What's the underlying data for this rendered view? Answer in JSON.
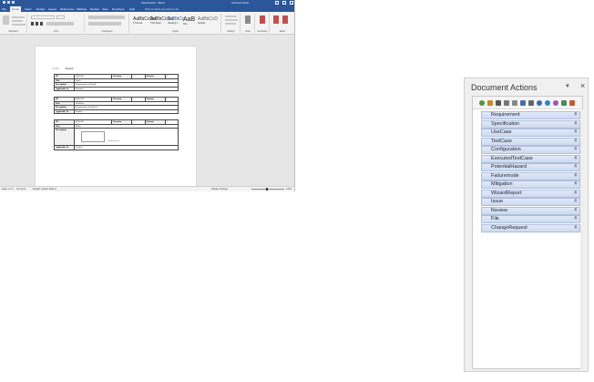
{
  "word": {
    "title": "Document1 - Word",
    "user": "Account name",
    "tabs": [
      "File",
      "Home",
      "Insert",
      "Design",
      "Layout",
      "References",
      "Mailings",
      "Review",
      "View",
      "Developer",
      "Help"
    ],
    "active_tab": "Home",
    "tell_me": "Tell me what you want to do",
    "ribbon_groups": [
      "Clipboard",
      "Font",
      "Paragraph",
      "Styles",
      "Editing",
      "Voice",
      "Sensitivity",
      "Editor"
    ],
    "styles": [
      {
        "sample": "AaBbCcDd",
        "name": "¶ Normal"
      },
      {
        "sample": "AaBbCcDd",
        "name": "¶ No Spac..."
      },
      {
        "sample": "AaBbCc",
        "name": "Heading 1"
      },
      {
        "sample": "AaB",
        "name": "Title"
      },
      {
        "sample": "AaBbCcD",
        "name": "Subtitle"
      }
    ],
    "heading": {
      "number": "1.1.1",
      "text": "Tappan"
    },
    "tables": [
      {
        "id_label": "ID",
        "id_value": "REQ-001",
        "rev_label": "Revision",
        "rev_value": "1",
        "pri_label": "Priority",
        "pri_value": "1",
        "rows": [
          {
            "label": "Title",
            "value": "Latch"
          },
          {
            "label": "Description",
            "value": "Requirements will latch"
          },
          {
            "label": "Applicable To",
            "value": "Software"
          }
        ]
      },
      {
        "id_label": "ID",
        "id_value": "REQ-002",
        "rev_label": "Revision",
        "rev_value": "1",
        "pri_label": "Priority",
        "pri_value": "1",
        "rows": [
          {
            "label": "Title",
            "value": "Lift Door"
          },
          {
            "label": "Description",
            "value": "Requirements will detect"
          },
          {
            "label": "Applicable To",
            "value": "Product"
          }
        ]
      },
      {
        "id_label": "ID",
        "id_value": "REQ-003",
        "rev_label": "Revision",
        "rev_value": "1",
        "pri_label": "Priority",
        "pri_value": "1",
        "rows": [
          {
            "label": "Title",
            "value": "Motor"
          },
          {
            "label": "Description",
            "value": "",
            "image_note": "Rotation speed"
          },
          {
            "label": "Applicable To",
            "value": "Product"
          }
        ]
      }
    ],
    "status": {
      "page": "Page 1 of 1",
      "words": "32 words",
      "language": "English (United States)",
      "focus": "Display Settings",
      "zoom": "100%"
    }
  },
  "actions": {
    "title": "Document Actions",
    "items": [
      "Requirement",
      "Specification",
      "UseCase",
      "TestCase",
      "Configuration",
      "ExecutedTestCase",
      "PotentialHazard",
      "Failuremode",
      "Mitigation",
      "WizardReport",
      "Issue",
      "Review",
      "File",
      "ChangeRequest"
    ],
    "toolbar_icons": [
      "refresh-icon",
      "tag-icon",
      "table-icon",
      "image-icon",
      "grid-icon",
      "document-icon",
      "box-icon",
      "info-icon",
      "globe-icon",
      "palette-icon",
      "link-icon",
      "export-icon"
    ]
  },
  "colors": {
    "word_blue": "#2b579a",
    "item_fill": "#d6e2f5",
    "item_border": "#aebfdc"
  }
}
